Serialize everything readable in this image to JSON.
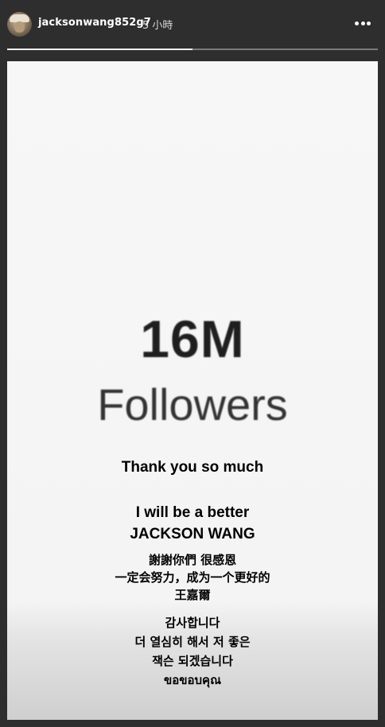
{
  "header": {
    "username": "jacksonwang852g7",
    "timestamp": "5 小時",
    "more_icon": "more-dots-icon"
  },
  "story": {
    "progress": 0.5,
    "count": "16M",
    "count_label": "Followers",
    "thanks": "Thank you so much",
    "promise_line1": "I will be a better",
    "promise_line2": "JACKSON WANG",
    "chinese_line1": "謝謝你們 很感恩",
    "chinese_line2": "一定会努力，成为一个更好的",
    "chinese_line3": "王嘉爾",
    "korean_line1": "감사합니다",
    "korean_line2": "더 열심히 해서 저 좋은",
    "korean_line3": "잭슨 되겠습니다",
    "thai_line": "ขอขอบคุณ"
  }
}
